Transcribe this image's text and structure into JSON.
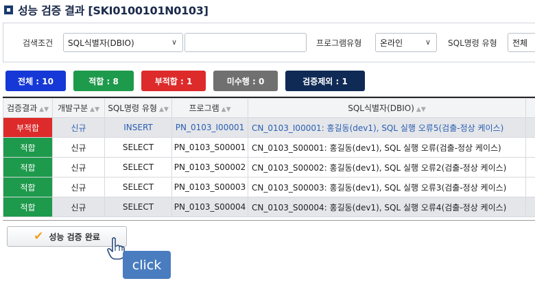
{
  "title": "성능 검증 결과 [SKI0100101N0103]",
  "search": {
    "condition_label": "검색조건",
    "condition_select": "SQL식별자(DBIO)",
    "condition_input": "",
    "program_type_label": "프로그램유형",
    "program_type_select": "온라인",
    "sql_type_label": "SQL명령 유형",
    "sql_type_select": "전체"
  },
  "badges": [
    {
      "label": "전체 : 10",
      "color": "#1538d6"
    },
    {
      "label": "적합 : 8",
      "color": "#1e9a4c"
    },
    {
      "label": "부적합 : 1",
      "color": "#dd2a2a"
    },
    {
      "label": "미수행 : 0",
      "color": "#707070"
    },
    {
      "label": "검증제외 : 1",
      "color": "#0f2a55"
    }
  ],
  "table": {
    "headers": [
      "검증결과",
      "개발구분",
      "SQL명령 유형",
      "프로그램",
      "SQL식별자(DBIO)"
    ],
    "rows": [
      {
        "result": "부적합",
        "dev": "신규",
        "sqltype": "INSERT",
        "program": "PN_0103_I00001",
        "sqlid": "CN_0103_I00001: 홍길동(dev1), SQL 실행 오류5(검출-정상 케이스)"
      },
      {
        "result": "적합",
        "dev": "신규",
        "sqltype": "SELECT",
        "program": "PN_0103_S00001",
        "sqlid": "CN_0103_S00001: 홍길동(dev1), SQL 실행 오류(검출-정상 케이스)"
      },
      {
        "result": "적합",
        "dev": "신규",
        "sqltype": "SELECT",
        "program": "PN_0103_S00002",
        "sqlid": "CN_0103_S00002: 홍길동(dev1), SQL 실행 오류2(검출-정상 케이스)"
      },
      {
        "result": "적합",
        "dev": "신규",
        "sqltype": "SELECT",
        "program": "PN_0103_S00003",
        "sqlid": "CN_0103_S00003: 홍길동(dev1), SQL 실행 오류3(검출-정상 케이스)"
      },
      {
        "result": "적합",
        "dev": "신규",
        "sqltype": "SELECT",
        "program": "PN_0103_S00004",
        "sqlid": "CN_0103_S00004: 홍길동(dev1), SQL 실행 오류4(검출-정상 케이스)"
      }
    ]
  },
  "complete_button": "성능 검증 완료",
  "tooltip": "click",
  "icons": {
    "title": "square-icon",
    "check": "check-icon",
    "hand": "hand-pointer-icon",
    "chevron": "chevron-down-icon",
    "sort": "sort-icon"
  }
}
